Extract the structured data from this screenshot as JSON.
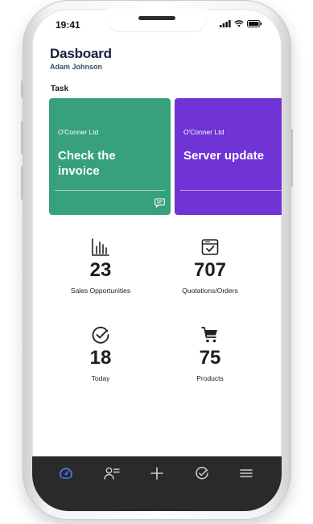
{
  "status_bar": {
    "time": "19:41"
  },
  "header": {
    "title": "Dasboard",
    "user_name": "Adam Johnson"
  },
  "task_section": {
    "label": "Task",
    "cards": [
      {
        "company": "O'Conner Ltd",
        "title": "Check the invoice",
        "color": "#36a17a"
      },
      {
        "company": "O'Conner Ltd",
        "title": "Server update",
        "color": "#6f33d6"
      }
    ]
  },
  "stats": [
    {
      "icon": "bar-chart-icon",
      "value": "23",
      "label": "Sales Opportunities"
    },
    {
      "icon": "document-check-icon",
      "value": "707",
      "label": "Quotations/Orders"
    },
    {
      "icon": "check-circle-icon",
      "value": "18",
      "label": "Today"
    },
    {
      "icon": "cart-icon",
      "value": "75",
      "label": "Products"
    }
  ],
  "tab_bar": {
    "active_color": "#4a7cf2",
    "tabs": [
      {
        "icon": "dashboard-gauge-icon",
        "active": true
      },
      {
        "icon": "contacts-list-icon",
        "active": false
      },
      {
        "icon": "plus-icon",
        "active": false
      },
      {
        "icon": "check-circle-icon",
        "active": false
      },
      {
        "icon": "menu-icon",
        "active": false
      }
    ]
  }
}
